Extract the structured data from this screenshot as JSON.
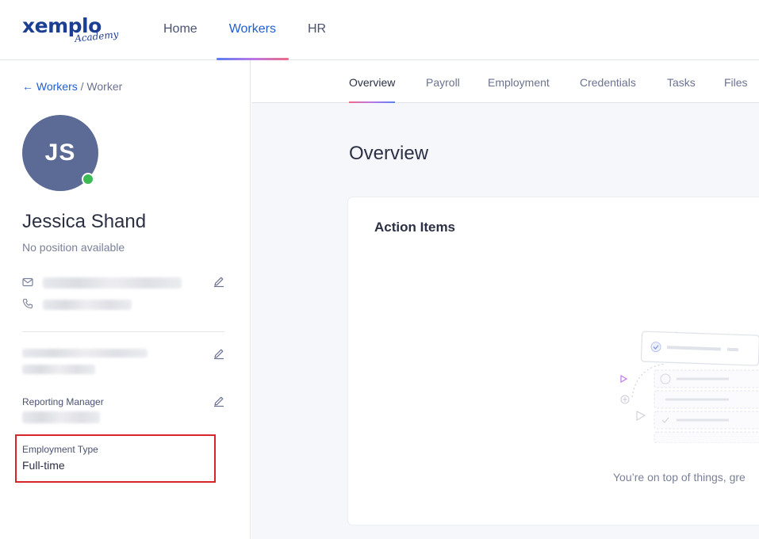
{
  "brand": {
    "logo_main": "xemplo",
    "logo_sub": "Academy"
  },
  "nav": {
    "items": [
      {
        "label": "Home",
        "active": false
      },
      {
        "label": "Workers",
        "active": true
      },
      {
        "label": "HR",
        "active": false
      }
    ]
  },
  "breadcrumb": {
    "arrow": "←",
    "parent": "Workers",
    "separator": "/",
    "current": "Worker"
  },
  "worker": {
    "initials": "JS",
    "name": "Jessica Shand",
    "position": "No position available",
    "status": "online"
  },
  "details": {
    "reporting_manager_label": "Reporting Manager",
    "employment_type_label": "Employment Type",
    "employment_type_value": "Full-time"
  },
  "tabs": [
    {
      "label": "Overview",
      "active": true
    },
    {
      "label": "Payroll",
      "active": false
    },
    {
      "label": "Employment",
      "active": false
    },
    {
      "label": "Credentials",
      "active": false
    },
    {
      "label": "Tasks",
      "active": false
    },
    {
      "label": "Files",
      "active": false
    }
  ],
  "main": {
    "title": "Overview",
    "card_title": "Action Items",
    "empty_message": "You’re on top of things, gre"
  },
  "colors": {
    "accent": "#1f5fcf",
    "avatar_bg": "#5b6b96",
    "presence_online": "#3cba54",
    "highlight_border": "#d7262b"
  },
  "icons": [
    "mail-icon",
    "phone-icon",
    "edit-icon",
    "arrow-left-icon"
  ]
}
